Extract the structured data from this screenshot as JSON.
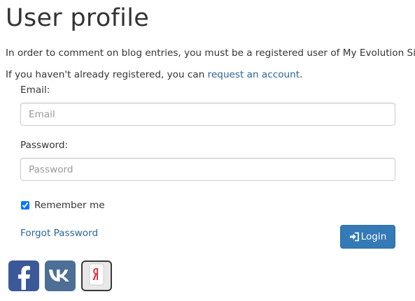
{
  "page": {
    "title": "User profile",
    "intro_line1": "In order to comment on blog entries, you must be a registered user of My Evolution Site.",
    "intro_line2_prefix": "If you haven't already registered, you can ",
    "intro_line2_link": "request an account",
    "intro_line2_suffix": "."
  },
  "form": {
    "email_label": "Email:",
    "email_placeholder": "Email",
    "email_value": "",
    "password_label": "Password:",
    "password_placeholder": "Password",
    "password_value": "",
    "remember_label": "Remember me",
    "remember_checked": true,
    "forgot_label": "Forgot Password",
    "login_label": "Login"
  },
  "social": {
    "facebook_icon": "facebook-icon",
    "vk_icon": "vk-icon",
    "yandex_icon": "yandex-icon"
  },
  "colors": {
    "link": "#2a6496",
    "primary_button": "#337ab7",
    "facebook": "#3b5998",
    "vk": "#4d6f96",
    "yandex_letter": "#e8202a"
  }
}
